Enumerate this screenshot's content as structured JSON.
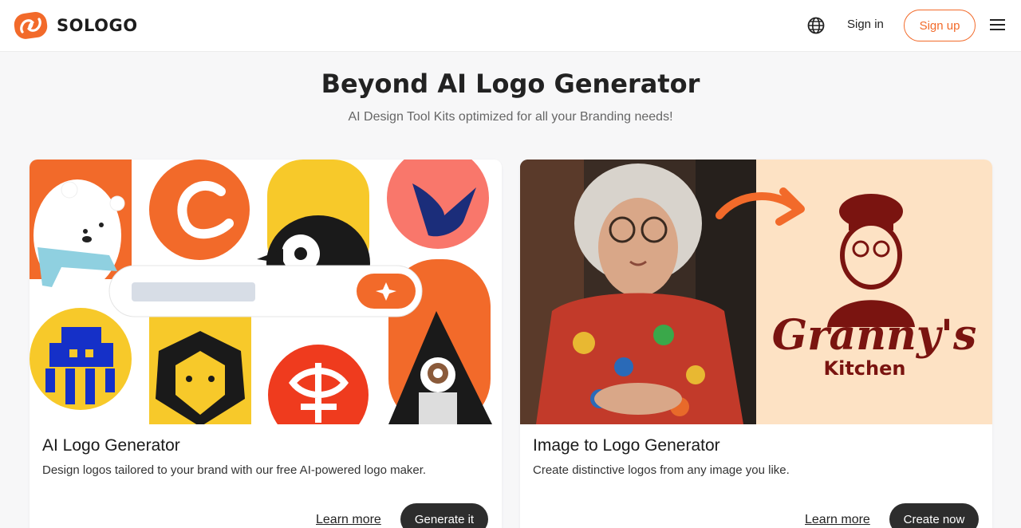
{
  "brand": {
    "name": "SOLOGO",
    "accent": "#f26a2a"
  },
  "header": {
    "language_icon": "globe-icon",
    "sign_in_label": "Sign in",
    "sign_up_label": "Sign up",
    "menu_icon": "hamburger-menu-icon"
  },
  "hero": {
    "title": "Beyond AI Logo Generator",
    "subtitle": "AI Design Tool Kits optimized for all your Branding needs!"
  },
  "cards": [
    {
      "title": "AI Logo Generator",
      "description": "Design logos tailored to your brand with our free AI-powered logo maker.",
      "learn_more_label": "Learn more",
      "cta_label": "Generate it"
    },
    {
      "title": "Image to Logo Generator",
      "description": "Create distinctive logos from any image you like.",
      "learn_more_label": "Learn more",
      "cta_label": "Create now",
      "image_logo_text_1": "Granny's",
      "image_logo_text_2": "Kitchen"
    }
  ]
}
